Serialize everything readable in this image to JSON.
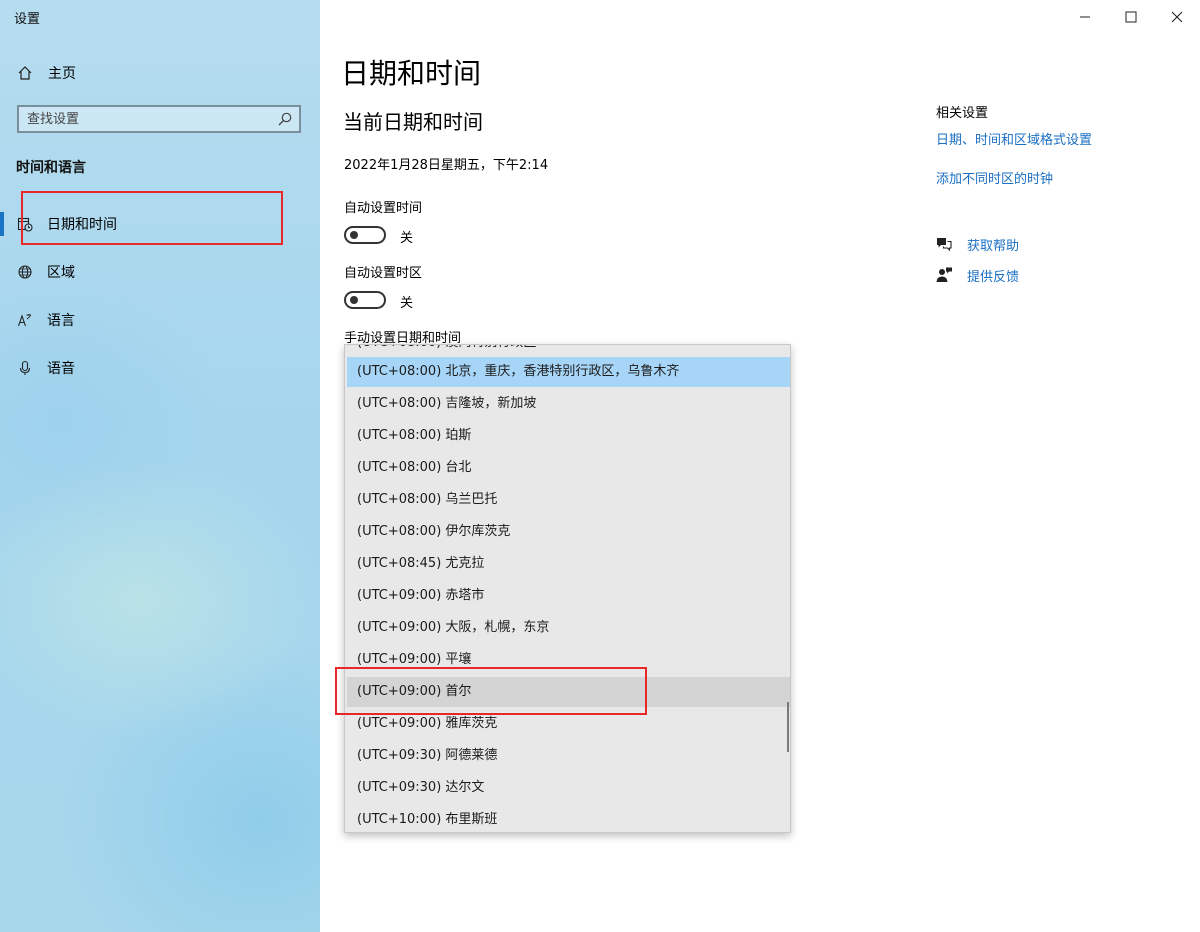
{
  "window": {
    "title": "设置",
    "controls": {
      "minimize": "minimize-icon",
      "maximize": "maximize-icon",
      "close": "close-icon"
    }
  },
  "sidebar": {
    "home_label": "主页",
    "search_placeholder": "查找设置",
    "section_title": "时间和语言",
    "items": [
      {
        "label": "日期和时间",
        "icon": "calendar-clock-icon",
        "active": true
      },
      {
        "label": "区域",
        "icon": "globe-icon",
        "active": false
      },
      {
        "label": "语言",
        "icon": "language-icon",
        "active": false
      },
      {
        "label": "语音",
        "icon": "microphone-icon",
        "active": false
      }
    ]
  },
  "main": {
    "page_title": "日期和时间",
    "section_title": "当前日期和时间",
    "current_datetime": "2022年1月28日星期五，下午2:14",
    "auto_time": {
      "label": "自动设置时间",
      "state": "关",
      "on": false
    },
    "auto_timezone": {
      "label": "自动设置时区",
      "state": "关",
      "on": false
    },
    "manual_label": "手动设置日期和时间"
  },
  "timezone_dropdown": {
    "items": [
      "(UTC+08:00) 北京，重庆，香港特别行政区，乌鲁木齐",
      "(UTC+08:00) 吉隆坡，新加坡",
      "(UTC+08:00) 珀斯",
      "(UTC+08:00) 台北",
      "(UTC+08:00) 乌兰巴托",
      "(UTC+08:00) 伊尔库茨克",
      "(UTC+08:45) 尤克拉",
      "(UTC+09:00) 赤塔市",
      "(UTC+09:00) 大阪，札幌，东京",
      "(UTC+09:00) 平壤",
      "(UTC+09:00) 首尔",
      "(UTC+09:00) 雅库茨克",
      "(UTC+09:30) 阿德莱德",
      "(UTC+09:30) 达尔文",
      "(UTC+10:00) 布里斯班"
    ],
    "selected": "(UTC+08:00) 北京，重庆，香港特别行政区，乌鲁木齐",
    "hovered": "(UTC+09:00) 首尔"
  },
  "related": {
    "title": "相关设置",
    "links": [
      "日期、时间和区域格式设置",
      "添加不同时区的时钟"
    ],
    "help": [
      {
        "label": "获取帮助",
        "icon": "help-chat-icon"
      },
      {
        "label": "提供反馈",
        "icon": "feedback-person-icon"
      }
    ]
  },
  "colors": {
    "accent": "#1a6fc2",
    "selected": "#a7d5f7",
    "annotation": "#e62828"
  }
}
